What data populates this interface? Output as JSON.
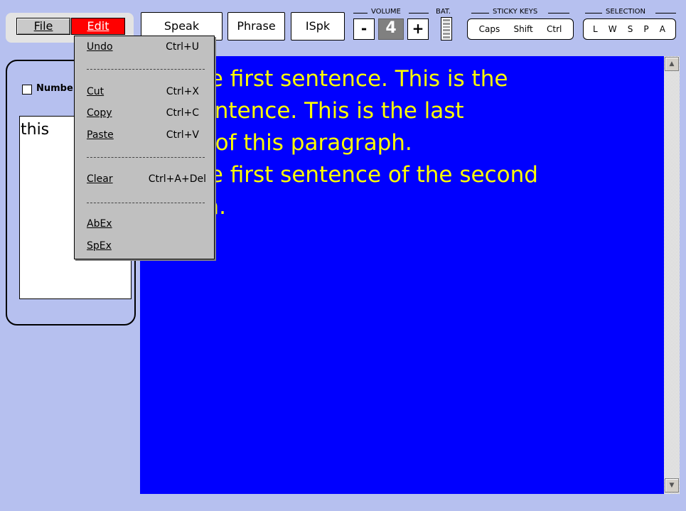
{
  "menu": {
    "file": "File",
    "edit": "Edit"
  },
  "toolbar": {
    "speak": "Speak",
    "phrase": "Phrase",
    "ispk": "ISpk"
  },
  "volume": {
    "label": "VOLUME",
    "minus": "-",
    "level": "4",
    "plus": "+"
  },
  "battery": {
    "label": "BAT."
  },
  "sticky_keys": {
    "label": "STICKY KEYS",
    "caps": "Caps",
    "shift": "Shift",
    "ctrl": "Ctrl"
  },
  "selection": {
    "label": "SELECTION",
    "l": "L",
    "w": "W",
    "s": "S",
    "p": "P",
    "a": "A"
  },
  "left_panel": {
    "number_label": "Numbe",
    "word": "this"
  },
  "text_area": {
    "lines": [
      "s the first sentence. This is the",
      "d sentence. This is the last",
      "nce of this paragraph.",
      "s the first sentence of the second",
      "raph."
    ]
  },
  "edit_menu": {
    "undo": "Undo",
    "undo_shortcut": "Ctrl+U",
    "separator": "------------------------",
    "cut": "Cut",
    "cut_shortcut": "Ctrl+X",
    "copy": "Copy",
    "copy_shortcut": "Ctrl+C",
    "paste": "Paste",
    "paste_shortcut": "Ctrl+V",
    "clear": "Clear",
    "clear_shortcut": "Ctrl+A+Del",
    "abex": "AbEx",
    "spex": "SpEx"
  },
  "colors": {
    "background": "#b6c0ef",
    "text_area": "#0000ff",
    "text": "#ffff00",
    "edit_active": "#ff0000"
  }
}
